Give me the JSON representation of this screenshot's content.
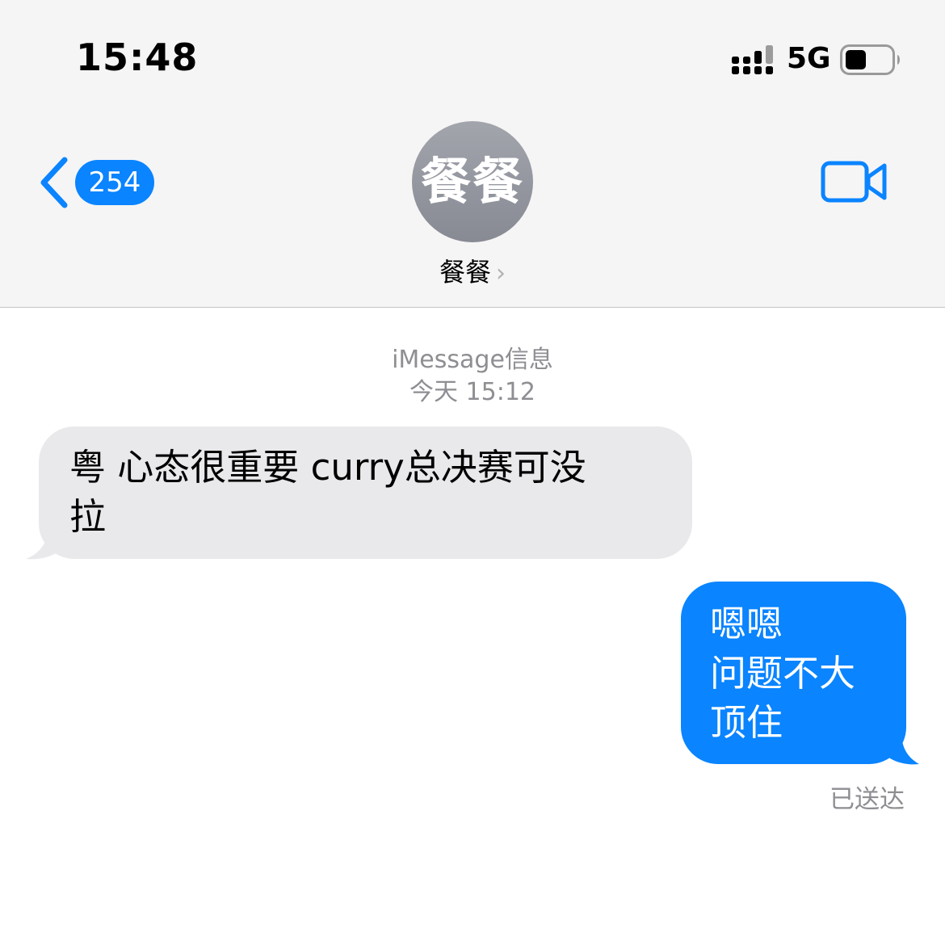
{
  "status_bar": {
    "time": "15:48",
    "network": "5G"
  },
  "nav": {
    "back_count": "254",
    "avatar_text": "餐餐",
    "contact_name": "餐餐",
    "contact_chevron": "›",
    "video_icon": "video-camera-icon",
    "accent_color": "#0a84ff"
  },
  "conversation": {
    "service_label": "iMessage信息",
    "timestamp": "今天 15:12",
    "messages": [
      {
        "direction": "incoming",
        "lines": [
          "粤 心态很重要  curry总决赛可没",
          "拉"
        ],
        "bubble_color": "#e9e9eb"
      },
      {
        "direction": "outgoing",
        "lines": [
          "嗯嗯",
          "问题不大",
          "顶住"
        ],
        "bubble_color": "#0a84ff"
      }
    ],
    "delivery_status": "已送达"
  }
}
